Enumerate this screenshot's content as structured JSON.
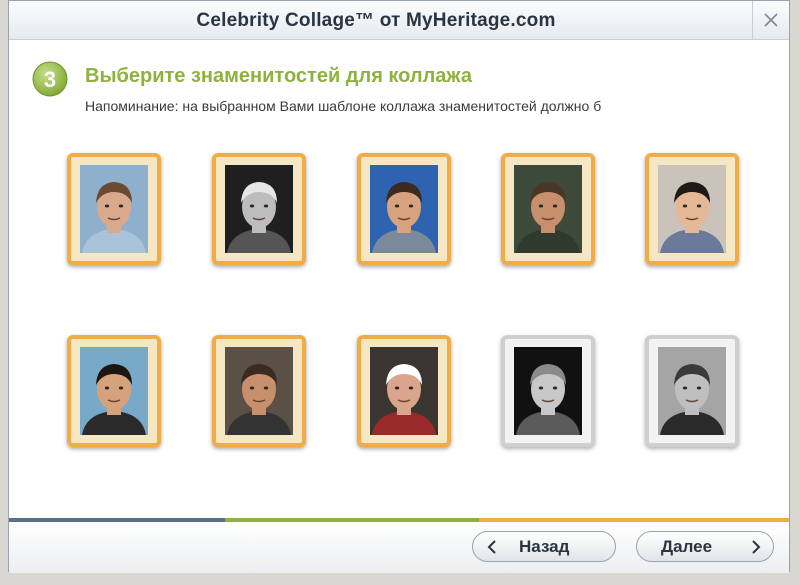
{
  "window": {
    "title": "Celebrity Collage™ от MyHeritage.com",
    "close_icon": "close-icon"
  },
  "step": {
    "number": "3",
    "heading": "Выберите знаменитостей для коллажа",
    "reminder": "Напоминание: на выбранном Вами шаблоне коллажа знаменитостей должно б"
  },
  "celebrities": [
    {
      "selected": true,
      "skin": "#d9a98c",
      "hair": "#6b4a32",
      "bg": "#8fb0cc",
      "shirt": "#a9c3da"
    },
    {
      "selected": true,
      "skin": "#bdbdbd",
      "hair": "#e6e6e6",
      "bg": "#1f1f1f",
      "shirt": "#555555"
    },
    {
      "selected": true,
      "skin": "#d8a27e",
      "hair": "#3b2a1e",
      "bg": "#2d63b0",
      "shirt": "#7a8a9a"
    },
    {
      "selected": true,
      "skin": "#c78f6b",
      "hair": "#4a3526",
      "bg": "#3d4a3a",
      "shirt": "#2f3a2f"
    },
    {
      "selected": true,
      "skin": "#e6b996",
      "hair": "#1e1a18",
      "bg": "#c9c3bb",
      "shirt": "#6b7a9a"
    },
    {
      "selected": true,
      "skin": "#d6a27c",
      "hair": "#1c1512",
      "bg": "#78a9c9",
      "shirt": "#2a2a2a"
    },
    {
      "selected": true,
      "skin": "#c88f6d",
      "hair": "#3a2a20",
      "bg": "#5a5046",
      "shirt": "#333333"
    },
    {
      "selected": true,
      "skin": "#d9a58c",
      "hair": "#ffffff",
      "bg": "#3a3530",
      "shirt": "#9a2a2a"
    },
    {
      "selected": false,
      "skin": "#c8c8c8",
      "hair": "#8a8a8a",
      "bg": "#111111",
      "shirt": "#5a5a5a"
    },
    {
      "selected": false,
      "skin": "#bfbfbf",
      "hair": "#3a3a3a",
      "bg": "#a5a5a5",
      "shirt": "#2a2a2a"
    }
  ],
  "buttons": {
    "back_label": "Назад",
    "next_label": "Далее"
  },
  "colors": {
    "accent_green": "#8db33e",
    "tile_selected_border": "#f2ac45",
    "progress": [
      "#5c6f86",
      "#8db33e",
      "#f2ac45"
    ]
  }
}
